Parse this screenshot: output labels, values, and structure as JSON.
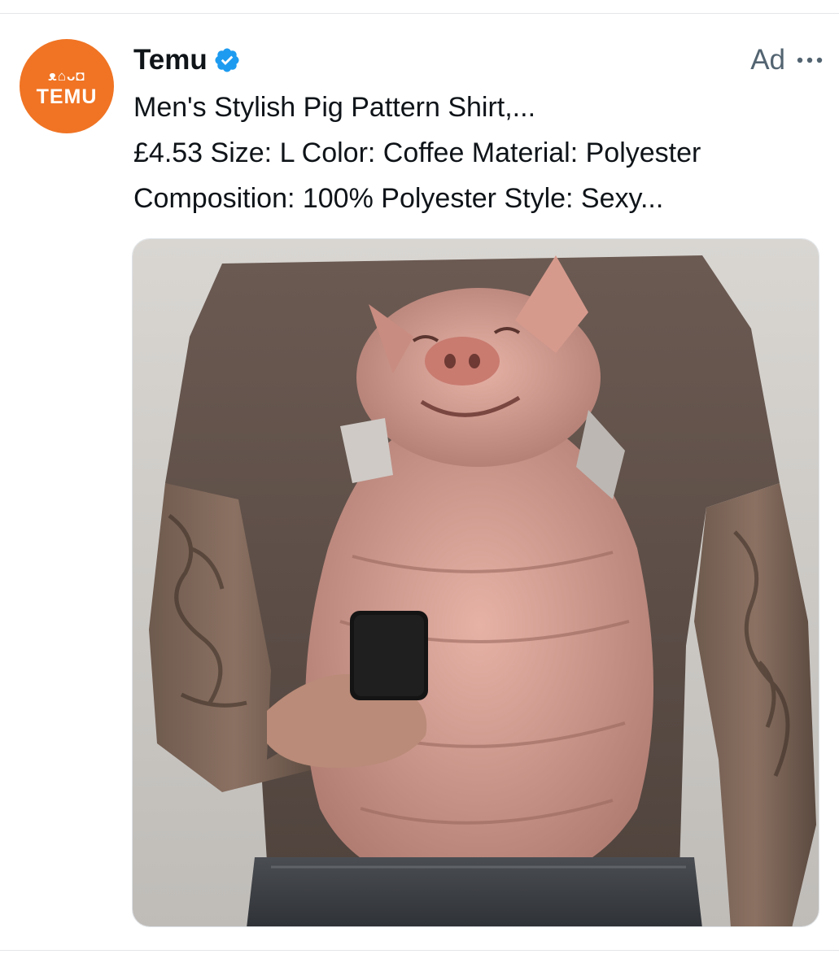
{
  "ad": {
    "account": {
      "avatar_glyphs": "ᴥ⌂ᴗ◘",
      "avatar_word": "TEMU",
      "name": "Temu",
      "verified": true,
      "brand_color": "#f07424",
      "verified_color": "#1d9bf0"
    },
    "label": "Ad",
    "more_icon": "ellipsis-horizontal-icon",
    "title": "Men's Stylish Pig Pattern Shirt,...",
    "description_line1": "£4.53 Size: L Color: Coffee Material: Polyester",
    "description_line2": "Composition: 100% Polyester Style: Sexy...",
    "media": {
      "description_icon": "product-photo"
    }
  }
}
